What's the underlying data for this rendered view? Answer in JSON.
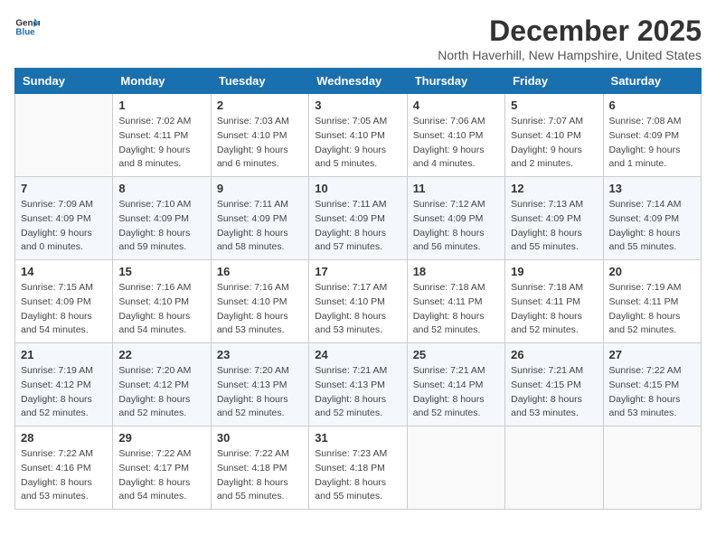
{
  "header": {
    "logo_general": "General",
    "logo_blue": "Blue",
    "month": "December 2025",
    "location": "North Haverhill, New Hampshire, United States"
  },
  "weekdays": [
    "Sunday",
    "Monday",
    "Tuesday",
    "Wednesday",
    "Thursday",
    "Friday",
    "Saturday"
  ],
  "weeks": [
    [
      {
        "day": "",
        "detail": ""
      },
      {
        "day": "1",
        "detail": "Sunrise: 7:02 AM\nSunset: 4:11 PM\nDaylight: 9 hours\nand 8 minutes."
      },
      {
        "day": "2",
        "detail": "Sunrise: 7:03 AM\nSunset: 4:10 PM\nDaylight: 9 hours\nand 6 minutes."
      },
      {
        "day": "3",
        "detail": "Sunrise: 7:05 AM\nSunset: 4:10 PM\nDaylight: 9 hours\nand 5 minutes."
      },
      {
        "day": "4",
        "detail": "Sunrise: 7:06 AM\nSunset: 4:10 PM\nDaylight: 9 hours\nand 4 minutes."
      },
      {
        "day": "5",
        "detail": "Sunrise: 7:07 AM\nSunset: 4:10 PM\nDaylight: 9 hours\nand 2 minutes."
      },
      {
        "day": "6",
        "detail": "Sunrise: 7:08 AM\nSunset: 4:09 PM\nDaylight: 9 hours\nand 1 minute."
      }
    ],
    [
      {
        "day": "7",
        "detail": "Sunrise: 7:09 AM\nSunset: 4:09 PM\nDaylight: 9 hours\nand 0 minutes."
      },
      {
        "day": "8",
        "detail": "Sunrise: 7:10 AM\nSunset: 4:09 PM\nDaylight: 8 hours\nand 59 minutes."
      },
      {
        "day": "9",
        "detail": "Sunrise: 7:11 AM\nSunset: 4:09 PM\nDaylight: 8 hours\nand 58 minutes."
      },
      {
        "day": "10",
        "detail": "Sunrise: 7:11 AM\nSunset: 4:09 PM\nDaylight: 8 hours\nand 57 minutes."
      },
      {
        "day": "11",
        "detail": "Sunrise: 7:12 AM\nSunset: 4:09 PM\nDaylight: 8 hours\nand 56 minutes."
      },
      {
        "day": "12",
        "detail": "Sunrise: 7:13 AM\nSunset: 4:09 PM\nDaylight: 8 hours\nand 55 minutes."
      },
      {
        "day": "13",
        "detail": "Sunrise: 7:14 AM\nSunset: 4:09 PM\nDaylight: 8 hours\nand 55 minutes."
      }
    ],
    [
      {
        "day": "14",
        "detail": "Sunrise: 7:15 AM\nSunset: 4:09 PM\nDaylight: 8 hours\nand 54 minutes."
      },
      {
        "day": "15",
        "detail": "Sunrise: 7:16 AM\nSunset: 4:10 PM\nDaylight: 8 hours\nand 54 minutes."
      },
      {
        "day": "16",
        "detail": "Sunrise: 7:16 AM\nSunset: 4:10 PM\nDaylight: 8 hours\nand 53 minutes."
      },
      {
        "day": "17",
        "detail": "Sunrise: 7:17 AM\nSunset: 4:10 PM\nDaylight: 8 hours\nand 53 minutes."
      },
      {
        "day": "18",
        "detail": "Sunrise: 7:18 AM\nSunset: 4:11 PM\nDaylight: 8 hours\nand 52 minutes."
      },
      {
        "day": "19",
        "detail": "Sunrise: 7:18 AM\nSunset: 4:11 PM\nDaylight: 8 hours\nand 52 minutes."
      },
      {
        "day": "20",
        "detail": "Sunrise: 7:19 AM\nSunset: 4:11 PM\nDaylight: 8 hours\nand 52 minutes."
      }
    ],
    [
      {
        "day": "21",
        "detail": "Sunrise: 7:19 AM\nSunset: 4:12 PM\nDaylight: 8 hours\nand 52 minutes."
      },
      {
        "day": "22",
        "detail": "Sunrise: 7:20 AM\nSunset: 4:12 PM\nDaylight: 8 hours\nand 52 minutes."
      },
      {
        "day": "23",
        "detail": "Sunrise: 7:20 AM\nSunset: 4:13 PM\nDaylight: 8 hours\nand 52 minutes."
      },
      {
        "day": "24",
        "detail": "Sunrise: 7:21 AM\nSunset: 4:13 PM\nDaylight: 8 hours\nand 52 minutes."
      },
      {
        "day": "25",
        "detail": "Sunrise: 7:21 AM\nSunset: 4:14 PM\nDaylight: 8 hours\nand 52 minutes."
      },
      {
        "day": "26",
        "detail": "Sunrise: 7:21 AM\nSunset: 4:15 PM\nDaylight: 8 hours\nand 53 minutes."
      },
      {
        "day": "27",
        "detail": "Sunrise: 7:22 AM\nSunset: 4:15 PM\nDaylight: 8 hours\nand 53 minutes."
      }
    ],
    [
      {
        "day": "28",
        "detail": "Sunrise: 7:22 AM\nSunset: 4:16 PM\nDaylight: 8 hours\nand 53 minutes."
      },
      {
        "day": "29",
        "detail": "Sunrise: 7:22 AM\nSunset: 4:17 PM\nDaylight: 8 hours\nand 54 minutes."
      },
      {
        "day": "30",
        "detail": "Sunrise: 7:22 AM\nSunset: 4:18 PM\nDaylight: 8 hours\nand 55 minutes."
      },
      {
        "day": "31",
        "detail": "Sunrise: 7:23 AM\nSunset: 4:18 PM\nDaylight: 8 hours\nand 55 minutes."
      },
      {
        "day": "",
        "detail": ""
      },
      {
        "day": "",
        "detail": ""
      },
      {
        "day": "",
        "detail": ""
      }
    ]
  ]
}
